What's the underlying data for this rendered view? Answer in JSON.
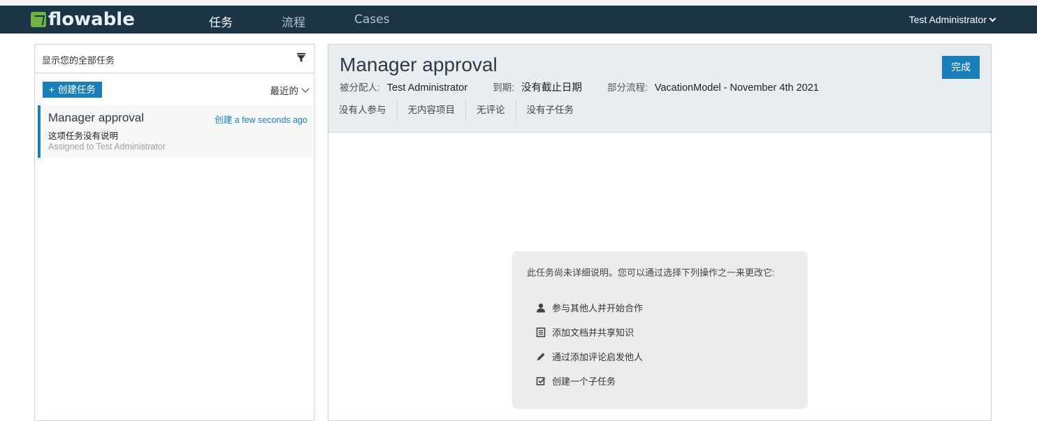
{
  "app": {
    "logo_text": "flowable",
    "brand_color": "#1b3547",
    "accent_color": "#1a7fb8",
    "logo_color": "#6fb344"
  },
  "nav": {
    "tabs": [
      {
        "label": "任务",
        "active": true
      },
      {
        "label": "流程",
        "active": false
      },
      {
        "label": "Cases",
        "active": false
      }
    ],
    "user": "Test Administrator"
  },
  "task_list": {
    "filter_label": "显示您的全部任务",
    "create_label": "创建任务",
    "sort_label": "最近的",
    "items": [
      {
        "name": "Manager approval",
        "created_prefix": "创建",
        "created_time": "a few seconds ago",
        "description": "这项任务没有说明",
        "assignee": "Assigned to Test Administrator"
      }
    ]
  },
  "detail": {
    "title": "Manager approval",
    "complete_label": "完成",
    "assignee_label": "被分配人:",
    "assignee_value": "Test Administrator",
    "due_label": "到期:",
    "due_value": "没有截止日期",
    "process_label": "部分流程:",
    "process_value": "VacationModel - November 4th 2021",
    "counts": [
      "没有人参与",
      "无内容项目",
      "无评论",
      "没有子任务"
    ],
    "help": {
      "intro": "此任务尚未详细说明。您可以通过选择下列操作之一来更改它:",
      "actions": [
        {
          "icon": "user-icon",
          "label": "参与其他人并开始合作"
        },
        {
          "icon": "document-icon",
          "label": "添加文档并共享知识"
        },
        {
          "icon": "pencil-icon",
          "label": "通过添加评论启发他人"
        },
        {
          "icon": "checkbox-icon",
          "label": "创建一个子任务"
        }
      ]
    }
  }
}
